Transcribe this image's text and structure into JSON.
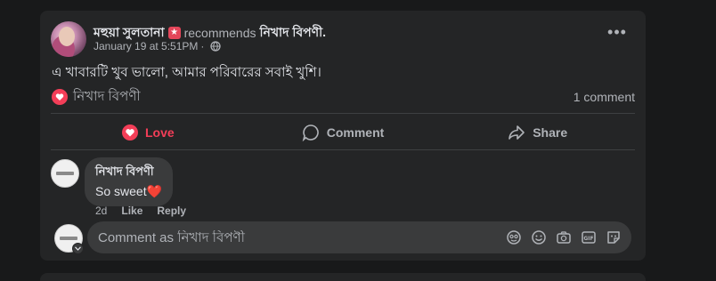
{
  "post": {
    "author": "মহুয়া সুলতানা",
    "recommends_label": "recommends",
    "page_name": "নিখাদ বিপণী.",
    "timestamp": "January 19 at 5:51PM",
    "separator": "·",
    "audience_icon": "globe-icon",
    "text": "এ খাবারটি খুব ভালো, আমার পরিবারের সবাই খুশি।",
    "reaction_name": "নিখাদ বিপণী",
    "comment_count": "1 comment"
  },
  "actions": {
    "love_label": "Love",
    "comment_label": "Comment",
    "share_label": "Share"
  },
  "comment": {
    "author": "নিখাদ বিপণী",
    "text": "So sweet",
    "emoji": "❤️",
    "age": "2d",
    "like_label": "Like",
    "reply_label": "Reply"
  },
  "composer": {
    "placeholder": "Comment as নিখাদ বিপণী",
    "icons": [
      "avatar-sticker-icon",
      "emoji-icon",
      "camera-icon",
      "gif-icon",
      "sticker-icon"
    ]
  },
  "colors": {
    "background": "#18191a",
    "card": "#242526",
    "love": "#f33e58",
    "secondary_text": "#b0b3b8"
  }
}
